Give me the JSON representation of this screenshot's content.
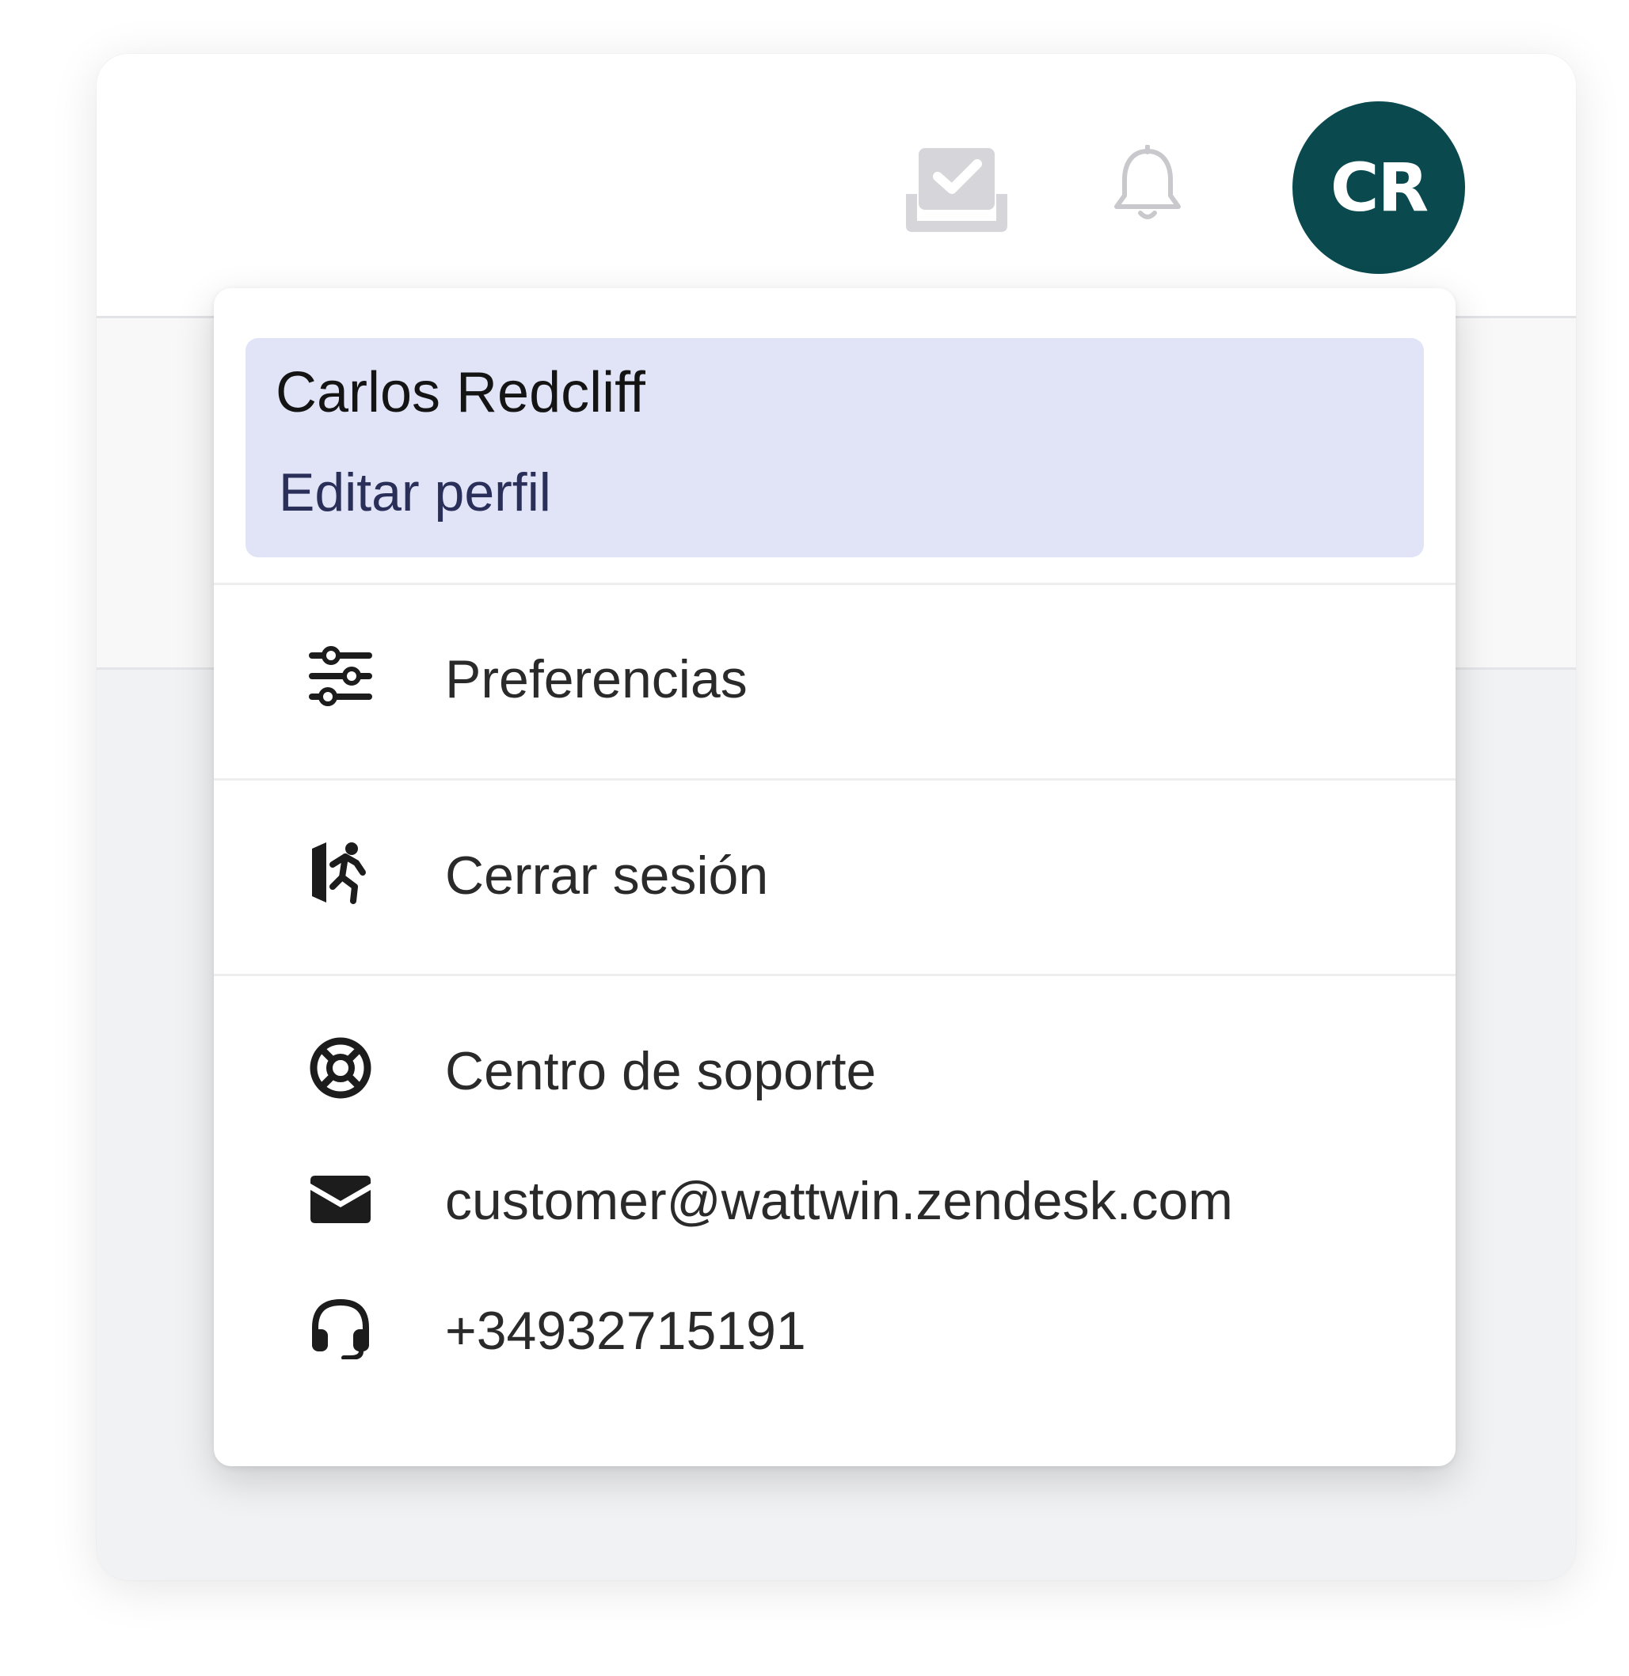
{
  "header": {
    "avatar_initials": "CR",
    "avatar_color": "#0a4a4f",
    "icons": {
      "tray": "inbox-check-icon",
      "bell": "bell-icon"
    }
  },
  "profile": {
    "name": "Carlos Redcliff",
    "edit_label": "Editar perfil",
    "highlight_color": "#e0e4f6"
  },
  "menu": {
    "items": [
      {
        "label": "Preferencias",
        "icon": "sliders-icon"
      },
      {
        "label": "Cerrar sesión",
        "icon": "exit-running-icon"
      },
      {
        "label": "Centro de soporte",
        "icon": "lifebuoy-icon"
      },
      {
        "label": "customer@wattwin.zendesk.com",
        "icon": "envelope-icon"
      },
      {
        "label": "+34932715191",
        "icon": "headset-icon"
      }
    ]
  }
}
